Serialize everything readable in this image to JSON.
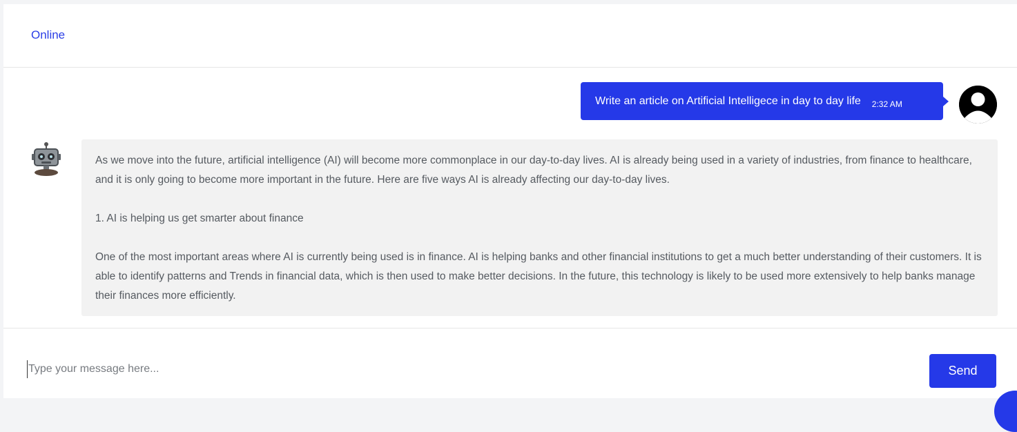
{
  "header": {
    "status": "Online"
  },
  "messages": {
    "user": {
      "text": "Write an article on Artificial Intelligece in day to day life",
      "time": "2:32 AM",
      "avatar_icon": "user-silhouette-icon"
    },
    "bot": {
      "avatar_icon": "robot-icon",
      "paragraphs": [
        "As we move into the future, artificial intelligence (AI) will become more commonplace in our day-to-day lives. AI is already being used in a variety of industries, from finance to healthcare, and it is only going to become more important in the future. Here are five ways AI is already affecting our day-to-day lives.",
        "1. AI is helping us get smarter about finance",
        "One of the most important areas where AI is currently being used is in finance. AI is helping banks and other financial institutions to get a much better understanding of their customers. It is able to identify patterns and Trends in financial data, which is then used to make better decisions. In the future, this technology is likely to be used more extensively to help banks manage their finances more efficiently."
      ]
    }
  },
  "composer": {
    "placeholder": "Type your message here...",
    "value": "",
    "send_label": "Send"
  },
  "colors": {
    "accent": "#2539e8",
    "status": "#2b3ee6",
    "bot_bubble_bg": "#f2f2f2",
    "bot_text": "#555a60"
  }
}
